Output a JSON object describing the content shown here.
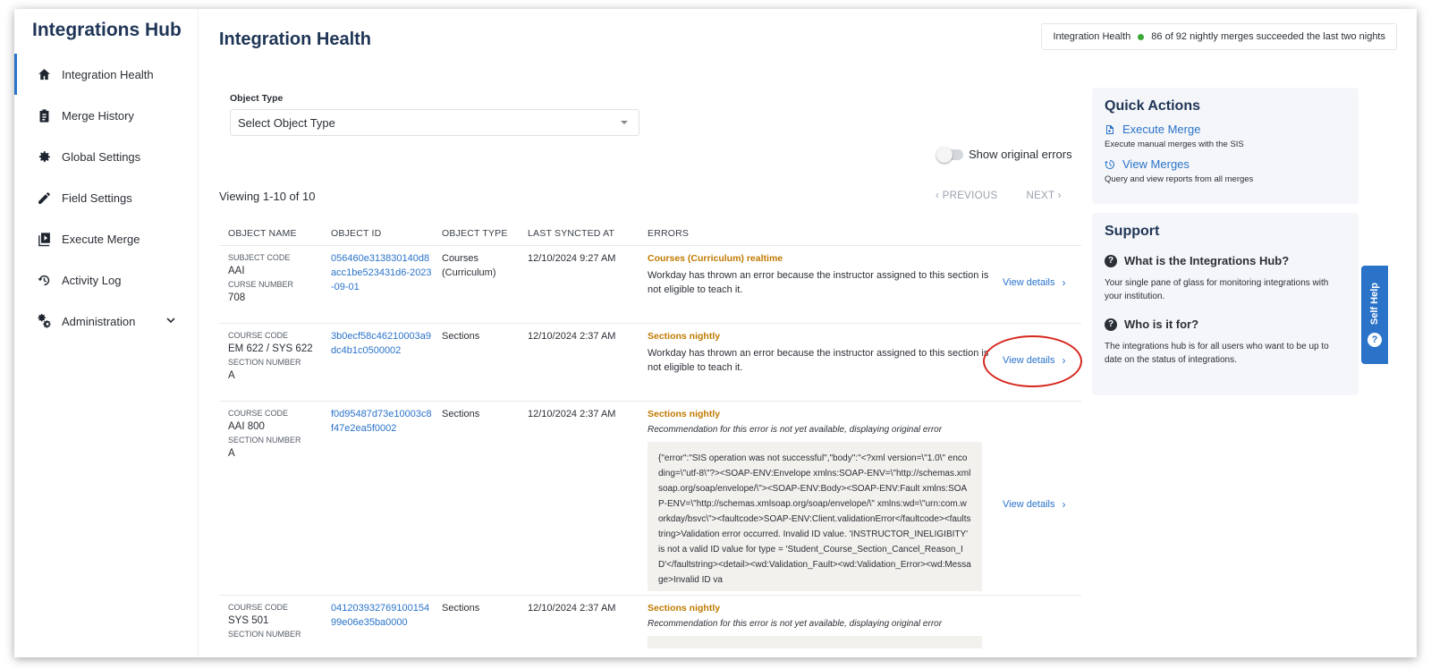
{
  "app": {
    "brand": "Integrations Hub"
  },
  "sidebar": {
    "items": [
      {
        "label": "Integration Health",
        "icon": "home-icon",
        "active": true
      },
      {
        "label": "Merge History",
        "icon": "clipboard-icon"
      },
      {
        "label": "Global Settings",
        "icon": "gear-icon"
      },
      {
        "label": "Field Settings",
        "icon": "pencil-icon"
      },
      {
        "label": "Execute Merge",
        "icon": "play-icon"
      },
      {
        "label": "Activity Log",
        "icon": "refresh-clock-icon"
      },
      {
        "label": "Administration",
        "icon": "gears-icon",
        "expandable": true
      }
    ]
  },
  "header": {
    "title": "Integration Health",
    "health_label": "Integration Health",
    "health_status": "86 of 92 nightly merges succeeded the last two nights",
    "status_color": "#3aa935"
  },
  "filter": {
    "label": "Object Type",
    "placeholder": "Select Object Type"
  },
  "toggle": {
    "label": "Show original errors",
    "on": false
  },
  "pagination": {
    "viewing": "Viewing 1-10 of 10",
    "previous": "PREVIOUS",
    "next": "NEXT"
  },
  "table": {
    "columns": [
      "OBJECT NAME",
      "OBJECT ID",
      "OBJECT TYPE",
      "LAST SYNCTED AT",
      "ERRORS"
    ],
    "view_details": "View details",
    "rows": [
      {
        "name_label1": "SUBJECT CODE",
        "name_val1": "AAI",
        "name_label2": "CURSE NUMBER",
        "name_val2": "708",
        "object_id": "056460e313830140d8acc1be523431d6-2023-09-01",
        "object_type": "Courses (Curriculum)",
        "synced": "12/10/2024 9:27 AM",
        "error_title": "Courses (Curriculum) realtime",
        "error_msg": "Workday has thrown an error because the instructor assigned to this section is not eligible to teach it."
      },
      {
        "name_label1": "COURSE CODE",
        "name_val1": "EM 622 / SYS 622",
        "name_label2": "SECTION NUMBER",
        "name_val2": "A",
        "object_id": "3b0ecf58c46210003a9dc4b1c0500002",
        "object_type": "Sections",
        "synced": "12/10/2024 2:37 AM",
        "error_title": "Sections nightly",
        "error_msg": "Workday has thrown an error because the instructor assigned to this section is not eligible to teach it."
      },
      {
        "name_label1": "COURSE CODE",
        "name_val1": "AAI 800",
        "name_label2": "SECTION NUMBER",
        "name_val2": "A",
        "object_id": "f0d95487d73e10003c8f47e2ea5f0002",
        "object_type": "Sections",
        "synced": "12/10/2024 2:37 AM",
        "error_title": "Sections nightly",
        "error_note": "Recommendation for this error is not yet available, displaying original error",
        "error_code": "{\"error\":\"SIS operation was not successful\",\"body\":\"<?xml version=\\\"1.0\\\" encoding=\\\"utf-8\\\"?><SOAP-ENV:Envelope xmlns:SOAP-ENV=\\\"http://schemas.xmlsoap.org/soap/envelope/\\\"><SOAP-ENV:Body><SOAP-ENV:Fault xmlns:SOAP-ENV=\\\"http://schemas.xmlsoap.org/soap/envelope/\\\" xmlns:wd=\\\"urn:com.workday/bsvc\\\"><faultcode>SOAP-ENV:Client.validationError</faultcode><faultstring>Validation error occurred. Invalid ID value. 'INSTRUCTOR_INELIGIBITY' is not a valid ID value for type = 'Student_Course_Section_Cancel_Reason_ID'</faultstring><detail><wd:Validation_Fault><wd:Validation_Error><wd:Message>Invalid ID va"
      },
      {
        "name_label1": "COURSE CODE",
        "name_val1": "SYS 501",
        "name_label2": "SECTION NUMBER",
        "name_val2": "",
        "object_id": "04120393276910015499e06e35ba0000",
        "object_type": "Sections",
        "synced": "12/10/2024 2:37 AM",
        "error_title": "Sections nightly",
        "error_note": "Recommendation for this error is not yet available, displaying original error"
      }
    ]
  },
  "quick_actions": {
    "title": "Quick Actions",
    "execute_label": "Execute Merge",
    "execute_desc": "Execute manual merges with the SIS",
    "view_label": "View Merges",
    "view_desc": "Query and view reports from all merges"
  },
  "support": {
    "title": "Support",
    "q1": "What is the Integrations Hub?",
    "a1": "Your single pane of glass for monitoring integrations with your institution.",
    "q2": "Who is it for?",
    "a2": "The integrations hub is for all users who want to be up to date on the status of integrations."
  },
  "self_help": {
    "label": "Self Help"
  },
  "colors": {
    "accent": "#2a73c9",
    "brand": "#1f3556",
    "warning": "#c07a00",
    "highlight": "#d6271c"
  }
}
